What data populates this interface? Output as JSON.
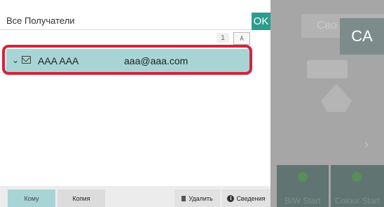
{
  "dialog": {
    "title": "Все Получатели",
    "ok_label": "OK",
    "page": "1",
    "sort_label": "Ā"
  },
  "recipients": [
    {
      "name": "AAA AAA",
      "email": "aaa@aaa.com"
    }
  ],
  "footer": {
    "to_label": "Кому",
    "cc_label": "Копия",
    "delete_label": "Удалить",
    "info_label": "Сведения"
  },
  "background": {
    "tab_label": "Сво",
    "ca_label": "CA",
    "start_bw_label": "B/W Start",
    "start_color_label": "Colour Start"
  },
  "colors": {
    "accent": "#2a9d8f",
    "selection": "#a8d4d5",
    "highlight": "#d6233d"
  }
}
